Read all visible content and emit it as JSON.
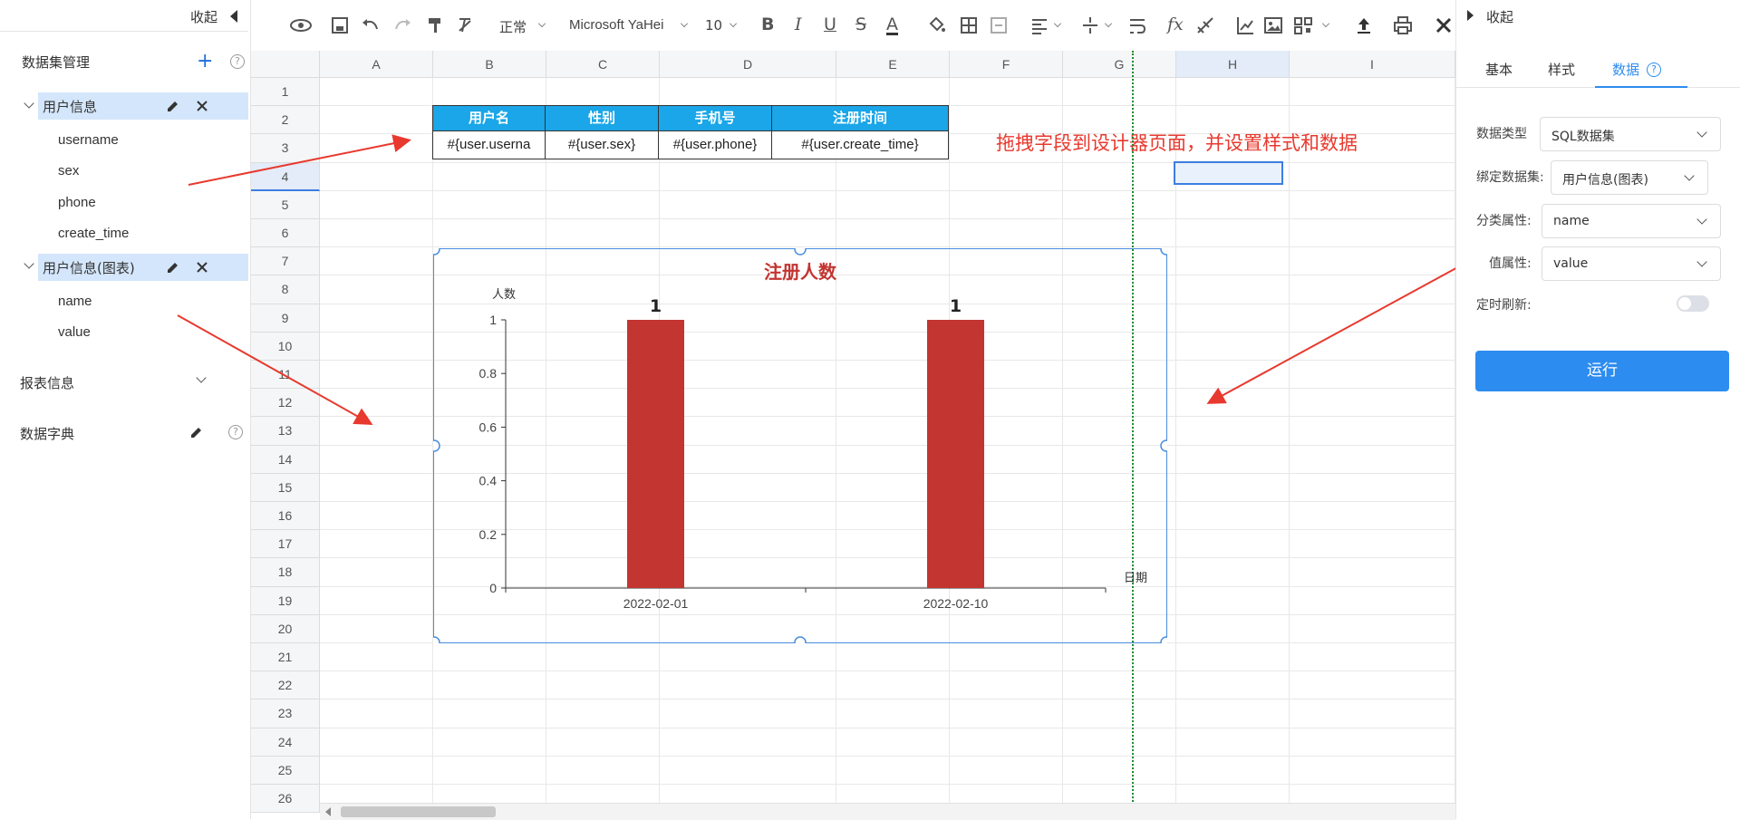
{
  "left": {
    "collapse_label": "收起",
    "dataset_title": "数据集管理",
    "datasets": [
      {
        "name": "用户信息",
        "fields": [
          "username",
          "sex",
          "phone",
          "create_time"
        ]
      },
      {
        "name": "用户信息(图表)",
        "fields": [
          "name",
          "value"
        ]
      }
    ],
    "report_info": "报表信息",
    "dictionary": "数据字典"
  },
  "toolbar": {
    "format": "正常",
    "font": "Microsoft YaHei",
    "size": "10"
  },
  "sheet": {
    "columns": [
      "A",
      "B",
      "C",
      "D",
      "E",
      "F",
      "G",
      "H",
      "I"
    ],
    "rows": [
      "1",
      "2",
      "3",
      "4",
      "5",
      "6",
      "7",
      "8",
      "9",
      "10",
      "11",
      "12",
      "13",
      "14",
      "15",
      "16",
      "17",
      "18",
      "19",
      "20",
      "21",
      "22",
      "23",
      "24",
      "25",
      "26"
    ],
    "table_headers": [
      "用户名",
      "性别",
      "手机号",
      "注册时间"
    ],
    "table_values": [
      "#{user.userna",
      "#{user.sex}",
      "#{user.phone}",
      "#{user.create_time}"
    ],
    "annotation": "拖拽字段到设计器页面，并设置样式和数据"
  },
  "chart_data": {
    "type": "bar",
    "title": "注册人数",
    "ylabel": "人数",
    "xlabel": "日期",
    "categories": [
      "2022-02-01",
      "2022-02-10"
    ],
    "values": [
      1,
      1
    ],
    "data_labels": [
      "1",
      "1"
    ],
    "ylim": [
      0,
      1
    ],
    "yticks": [
      "0",
      "0.2",
      "0.4",
      "0.6",
      "0.8",
      "1"
    ],
    "bar_color": "#c23531",
    "title_color": "#c23531"
  },
  "right": {
    "collapse_label": "收起",
    "tabs": [
      "基本",
      "样式",
      "数据"
    ],
    "active_tab": "数据",
    "props": {
      "data_type_label": "数据类型",
      "data_type": "SQL数据集",
      "bind_label": "绑定数据集:",
      "bind_value": "用户信息(图表)",
      "category_label": "分类属性:",
      "category_value": "name",
      "value_label": "值属性:",
      "value_value": "value",
      "refresh_label": "定时刷新:"
    },
    "run_label": "运行"
  },
  "colors": {
    "accent": "#2d8cf0",
    "header_blue": "#1aa6e8",
    "arrow_red": "#e8392e"
  }
}
